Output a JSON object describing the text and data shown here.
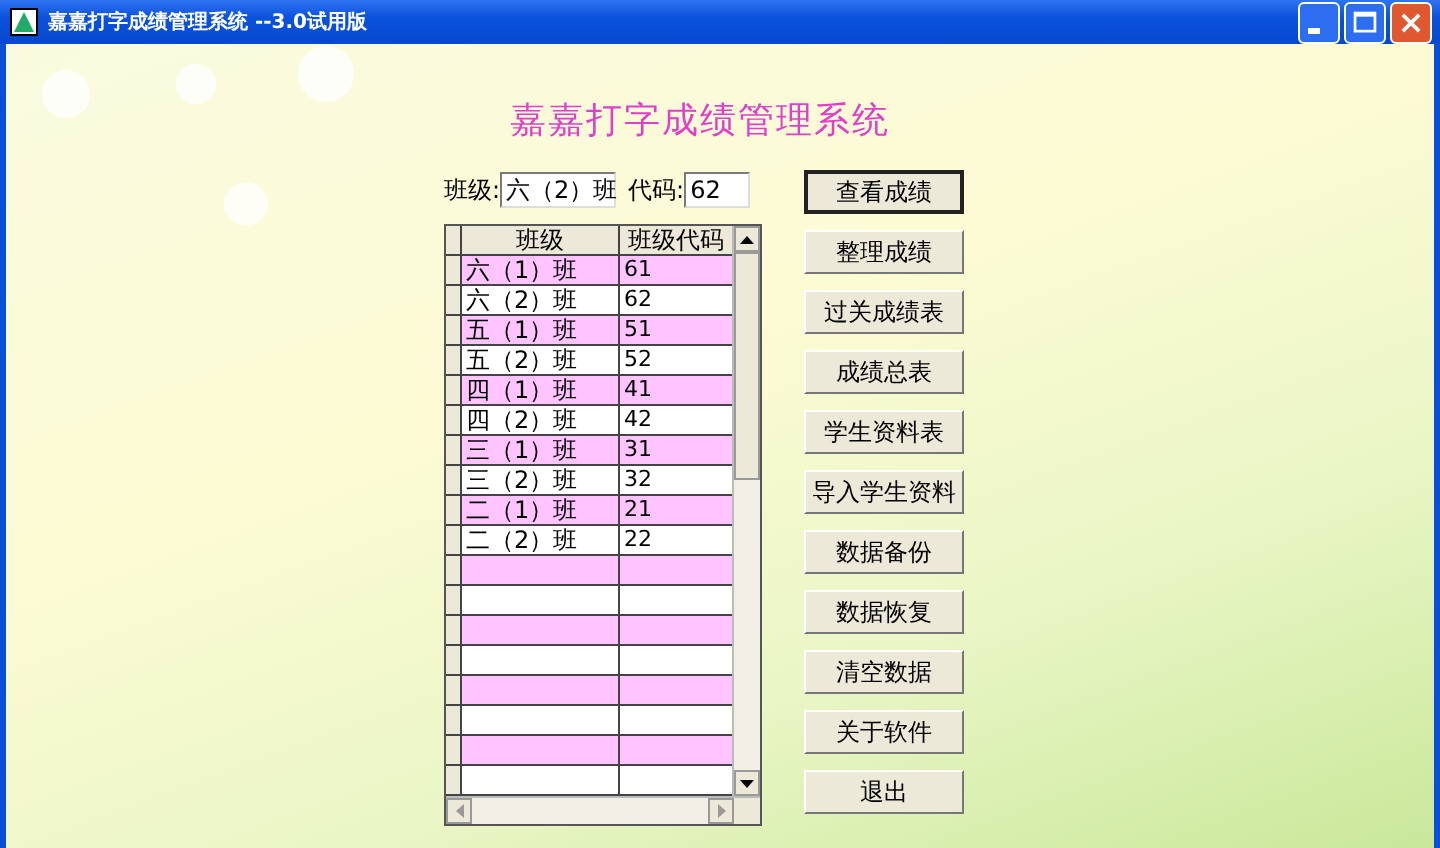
{
  "window": {
    "title": "嘉嘉打字成绩管理系统 --3.0试用版"
  },
  "heading": "嘉嘉打字成绩管理系统",
  "class_field": {
    "label": "班级:",
    "value": "六（2）班"
  },
  "code_field": {
    "label": "代码:",
    "value": "62"
  },
  "table": {
    "columns": [
      "班级",
      "班级代码"
    ],
    "rows": [
      [
        "六（1）班",
        "61"
      ],
      [
        "六（2）班",
        "62"
      ],
      [
        "五（1）班",
        "51"
      ],
      [
        "五（2）班",
        "52"
      ],
      [
        "四（1）班",
        "41"
      ],
      [
        "四（2）班",
        "42"
      ],
      [
        "三（1）班",
        "31"
      ],
      [
        "三（2）班",
        "32"
      ],
      [
        "二（1）班",
        "21"
      ],
      [
        "二（2）班",
        "22"
      ]
    ]
  },
  "buttons": [
    {
      "label": "查看成绩",
      "focused": true
    },
    {
      "label": "整理成绩",
      "focused": false
    },
    {
      "label": "过关成绩表",
      "focused": false
    },
    {
      "label": "成绩总表",
      "focused": false
    },
    {
      "label": "学生资料表",
      "focused": false
    },
    {
      "label": "导入学生资料",
      "focused": false
    },
    {
      "label": "数据备份",
      "focused": false
    },
    {
      "label": "数据恢复",
      "focused": false
    },
    {
      "label": "清空数据",
      "focused": false
    },
    {
      "label": "关于软件",
      "focused": false
    },
    {
      "label": "退出",
      "focused": false
    }
  ]
}
